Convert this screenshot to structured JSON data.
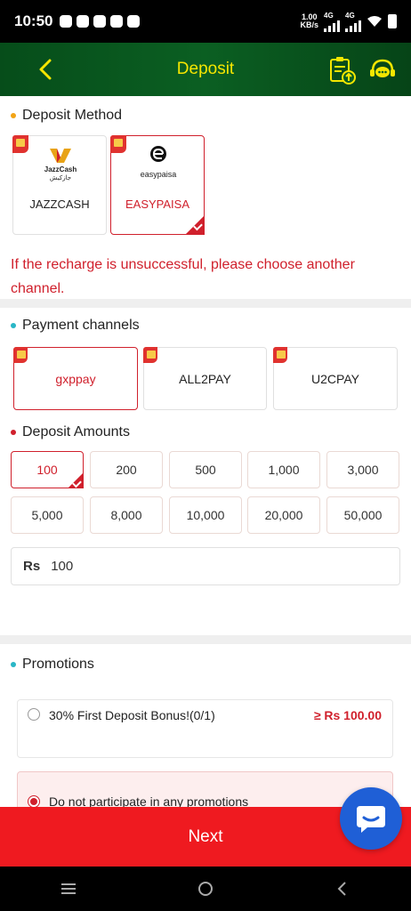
{
  "status_bar": {
    "time": "10:50",
    "net_speed_value": "1.00",
    "net_speed_unit": "KB/s",
    "network_1": "4G",
    "network_2": "4G"
  },
  "header": {
    "title": "Deposit",
    "back_icon": "chevron-left-icon",
    "history_icon": "clipboard-upload-icon",
    "support_icon": "headset-chat-icon",
    "title_color": "#f5e600"
  },
  "deposit_method": {
    "title": "Deposit Method",
    "dot_color": "#f2a416",
    "methods": [
      {
        "label": "JAZZCASH",
        "logo_text": "JazzCash",
        "logo_subtext": "جازکیش",
        "selected": false
      },
      {
        "label": "EASYPAISA",
        "logo_text": "easypaisa",
        "selected": true
      }
    ]
  },
  "warning": "If the recharge is unsuccessful, please choose another channel.",
  "payment_channels": {
    "title": "Payment channels",
    "dot_color": "#29b6c6",
    "channels": [
      {
        "label": "gxppay",
        "selected": true
      },
      {
        "label": "ALL2PAY",
        "selected": false
      },
      {
        "label": "U2CPAY",
        "selected": false
      }
    ]
  },
  "deposit_amounts": {
    "title": "Deposit Amounts",
    "dot_color": "#d0202c",
    "amounts": [
      "100",
      "200",
      "500",
      "1,000",
      "3,000",
      "5,000",
      "8,000",
      "10,000",
      "20,000",
      "50,000"
    ],
    "selected_index": 0
  },
  "amount_input": {
    "currency": "Rs",
    "value": "100"
  },
  "promotions": {
    "title": "Promotions",
    "dot_color": "#29b6c6",
    "items": [
      {
        "label": "30% First Deposit Bonus!(0/1)",
        "min": "≥ Rs 100.00",
        "selected": false
      },
      {
        "label": "Do not participate in any promotions",
        "selected": true
      }
    ]
  },
  "next_button": "Next",
  "colors": {
    "accent_red": "#d0202c",
    "next_bar": "#ef1a20",
    "header_green": "#0b5f22",
    "chat_blue": "#1f5fd6"
  }
}
